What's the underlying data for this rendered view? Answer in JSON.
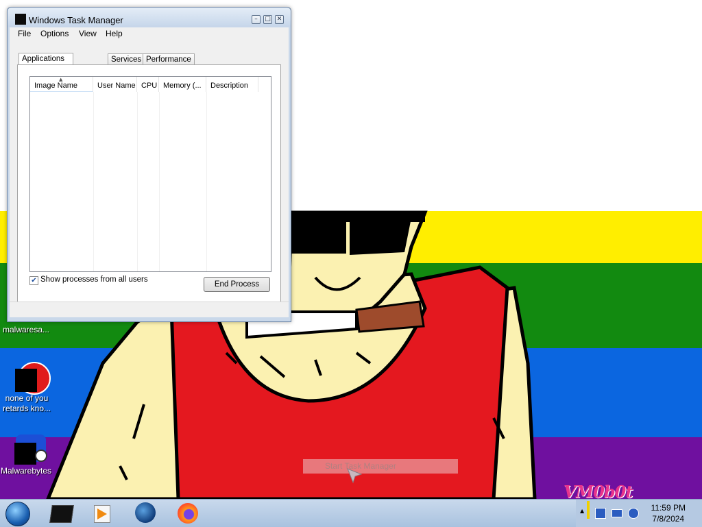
{
  "window": {
    "title": "Windows Task Manager",
    "menu": [
      "File",
      "Options",
      "View",
      "Help"
    ],
    "tabs": [
      "Applications",
      "Services",
      "Performance"
    ],
    "active_tab": "Applications",
    "columns": [
      "Image Name",
      "User Name",
      "CPU",
      "Memory (...",
      "Description"
    ],
    "show_all_users_label": "Show processes from all users",
    "show_all_users_checked": true,
    "end_process_label": "End Process"
  },
  "desktop": {
    "icons": [
      {
        "label": "malwaresa...",
        "icon": "shield-app-icon"
      },
      {
        "label": "none of you retards kno...",
        "icon": "black-square-app-icon"
      },
      {
        "label": "Malwarebytes",
        "icon": "malwarebytes-icon"
      }
    ],
    "overlay_text": "Start Task Manager",
    "watermark": "VM0b0t"
  },
  "taskbar": {
    "time": "11:59 PM",
    "date": "7/8/2024",
    "pinned": [
      "terminal-icon",
      "media-player-icon",
      "browser-globe-icon",
      "firefox-icon"
    ]
  },
  "colors": {
    "stripe_yellow": "#ffee00",
    "stripe_green": "#128a10",
    "stripe_blue": "#0b66e0",
    "stripe_purple": "#6f109f",
    "tank_red": "#e4181f",
    "skin": "#fbf1b1"
  }
}
